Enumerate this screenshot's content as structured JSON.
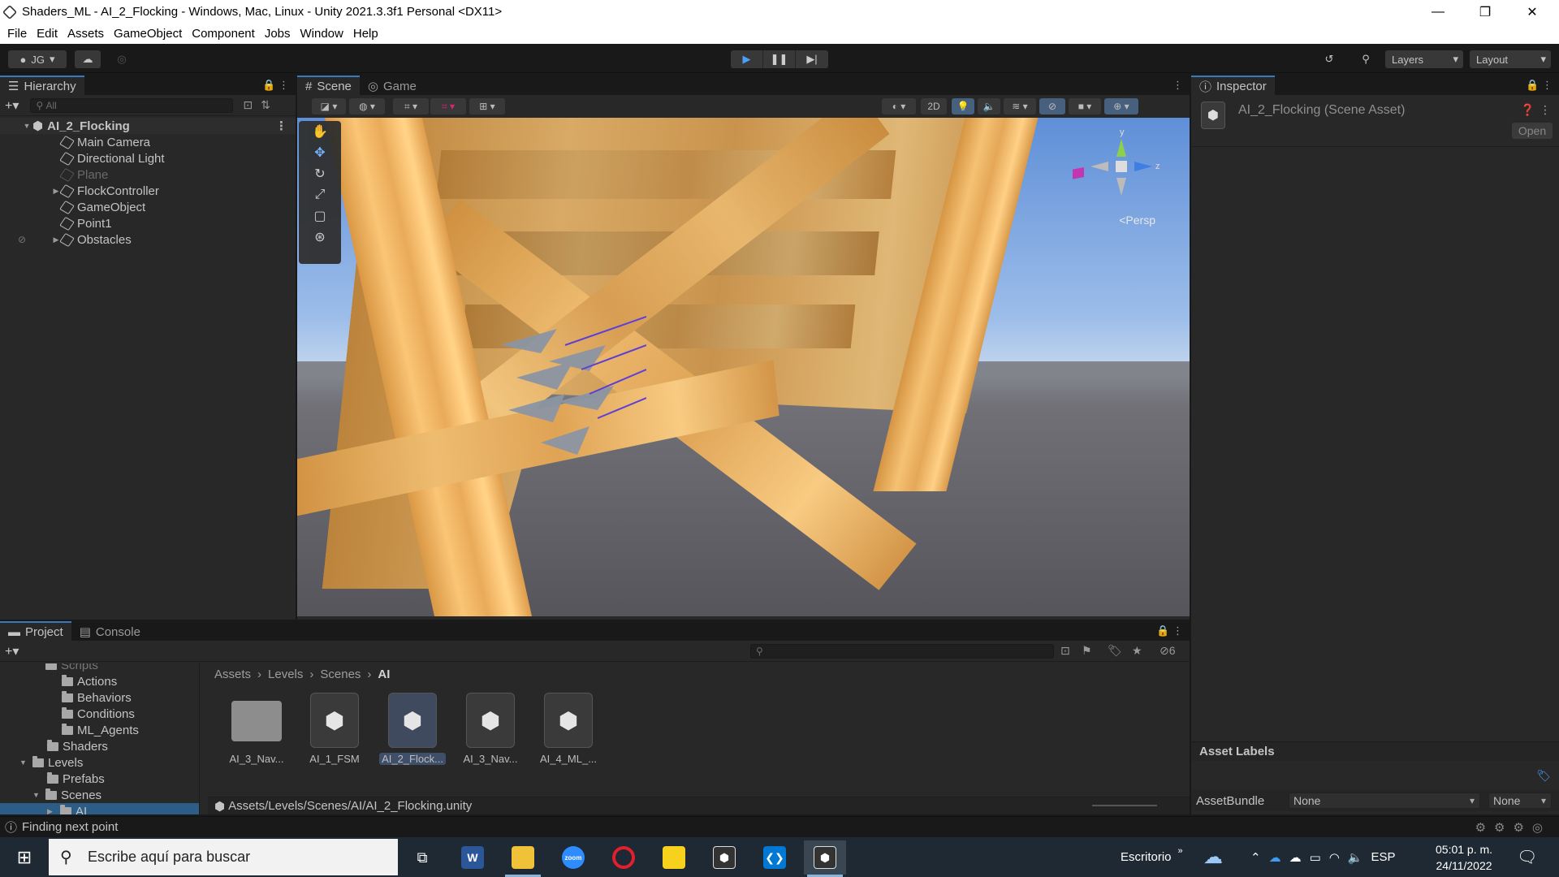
{
  "window": {
    "title": "Shaders_ML - AI_2_Flocking - Windows, Mac, Linux - Unity 2021.3.3f1 Personal <DX11>",
    "minimize": "—",
    "maximize": "❐",
    "close": "✕"
  },
  "menu": [
    "File",
    "Edit",
    "Assets",
    "GameObject",
    "Component",
    "Jobs",
    "Window",
    "Help"
  ],
  "toolbar": {
    "account": "JG",
    "layers": "Layers",
    "layout": "Layout"
  },
  "hierarchy": {
    "tab": "Hierarchy",
    "search_placeholder": "All",
    "scene": "AI_2_Flocking",
    "items": [
      {
        "label": "Main Camera",
        "dim": false,
        "expandable": false
      },
      {
        "label": "Directional Light",
        "dim": false,
        "expandable": false
      },
      {
        "label": "Plane",
        "dim": true,
        "expandable": false
      },
      {
        "label": "FlockController",
        "dim": false,
        "expandable": true
      },
      {
        "label": "GameObject",
        "dim": false,
        "expandable": false
      },
      {
        "label": "Point1",
        "dim": false,
        "expandable": false
      },
      {
        "label": "Obstacles",
        "dim": false,
        "expandable": true
      }
    ]
  },
  "scene": {
    "tabs": [
      "Scene",
      "Game"
    ],
    "mode_2d": "2D",
    "persp_label": "Persp",
    "axis_y": "y",
    "axis_z": "z"
  },
  "inspector": {
    "tab": "Inspector",
    "asset_title": "AI_2_Flocking (Scene Asset)",
    "open_button": "Open",
    "labels_header": "Asset Labels",
    "bundle_label": "AssetBundle",
    "bundle_value": "None",
    "variant_value": "None"
  },
  "project": {
    "tabs": [
      "Project",
      "Console"
    ],
    "hidden_count": "6",
    "folders": [
      {
        "label": "Scripts",
        "indent": 3,
        "clipped": true
      },
      {
        "label": "Actions",
        "indent": 4
      },
      {
        "label": "Behaviors",
        "indent": 4
      },
      {
        "label": "Conditions",
        "indent": 4
      },
      {
        "label": "ML_Agents",
        "indent": 4
      },
      {
        "label": "Shaders",
        "indent": 3
      },
      {
        "label": "Levels",
        "indent": 2,
        "expanded": true
      },
      {
        "label": "Prefabs",
        "indent": 3
      },
      {
        "label": "Scenes",
        "indent": 3,
        "expanded": true
      },
      {
        "label": "AI",
        "indent": 4,
        "selected": true
      }
    ],
    "breadcrumb": [
      "Assets",
      "Levels",
      "Scenes",
      "AI"
    ],
    "assets": [
      {
        "label": "AI_3_Nav...",
        "kind": "folder"
      },
      {
        "label": "AI_1_FSM",
        "kind": "scene"
      },
      {
        "label": "AI_2_Flock...",
        "kind": "scene",
        "selected": true
      },
      {
        "label": "AI_3_Nav...",
        "kind": "scene"
      },
      {
        "label": "AI_4_ML_...",
        "kind": "scene"
      }
    ],
    "path": "Assets/Levels/Scenes/AI/AI_2_Flocking.unity"
  },
  "status": {
    "message": "Finding next point"
  },
  "taskbar": {
    "search_placeholder": "Escribe aquí para buscar",
    "desktop_label": "Escritorio",
    "language": "ESP",
    "time": "05:01 p. m.",
    "date": "24/11/2022",
    "zoom_label": "zoom"
  }
}
